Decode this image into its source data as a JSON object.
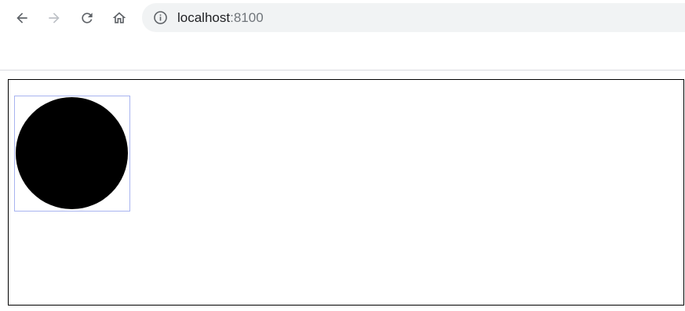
{
  "browser": {
    "url_host": "localhost",
    "url_port": ":8100",
    "icons": {
      "back": "arrow-left-icon",
      "forward": "arrow-right-icon",
      "reload": "reload-icon",
      "home": "home-icon",
      "site_info": "info-circle-icon"
    },
    "colors": {
      "icon_active": "#5f6368",
      "icon_disabled": "#bdc1c6",
      "omnibox_bg": "#f1f3f4"
    }
  },
  "page": {
    "shape": "circle",
    "shape_fill": "#000000",
    "selection_color": "#a8b4f0",
    "stage_border": "#000000"
  }
}
